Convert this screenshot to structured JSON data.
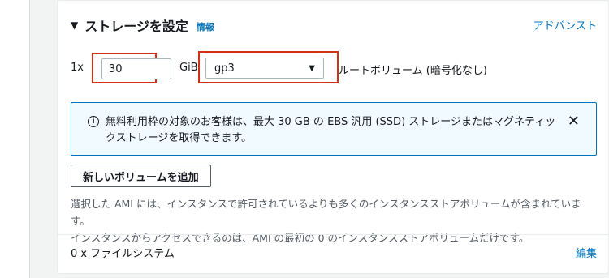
{
  "storage": {
    "title": "ストレージを設定",
    "info_link": "情報",
    "advanced_link": "アドバンスト",
    "volume": {
      "quantity_prefix": "1x",
      "size_value": "30",
      "unit": "GiB",
      "type_selected": "gp3",
      "description": "ルートボリューム (暗号化なし)"
    },
    "alert": {
      "text": "無料利用枠の対象のお客様は、最大 30 GB の EBS 汎用 (SSD) ストレージまたはマグネティックストレージを取得できます。"
    },
    "add_volume_label": "新しいボリュームを追加",
    "note_line1": "選択した AMI には、インスタンスで許可されているよりも多くのインスタンスストアボリュームが含まれています。",
    "note_line2": "インスタンスからアクセスできるのは、AMI の最初の 0 のインスタンスストアボリュームだけです。",
    "file_systems_label": "0 x ファイルシステム",
    "edit_link": "編集"
  },
  "colors": {
    "link": "#0073bb",
    "highlight": "#d13212",
    "alert_bg": "#f1faff"
  }
}
